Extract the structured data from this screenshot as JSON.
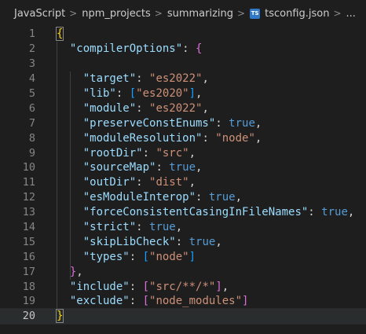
{
  "breadcrumb": {
    "items": [
      "JavaScript",
      "npm_projects",
      "summarizing"
    ],
    "file_icon": "TS",
    "file": "tsconfig.json",
    "tail": "..."
  },
  "editor": {
    "line_numbers": [
      "1",
      "2",
      "3",
      "4",
      "5",
      "6",
      "7",
      "8",
      "9",
      "10",
      "11",
      "12",
      "13",
      "14",
      "15",
      "16",
      "17",
      "18",
      "19",
      "20"
    ],
    "current_line": 20,
    "tokens": {
      "open_brace": "{",
      "close_brace": "}",
      "compilerOptions": "\"compilerOptions\"",
      "target": "\"target\"",
      "target_val": "\"es2022\"",
      "lib": "\"lib\"",
      "lib_val": "\"es2020\"",
      "module": "\"module\"",
      "module_val": "\"es2022\"",
      "preserveConstEnums": "\"preserveConstEnums\"",
      "moduleResolution": "\"moduleResolution\"",
      "moduleResolution_val": "\"node\"",
      "rootDir": "\"rootDir\"",
      "rootDir_val": "\"src\"",
      "sourceMap": "\"sourceMap\"",
      "outDir": "\"outDir\"",
      "outDir_val": "\"dist\"",
      "esModuleInterop": "\"esModuleInterop\"",
      "forceConsistentCasingInFileNames": "\"forceConsistentCasingInFileNames\"",
      "strict": "\"strict\"",
      "skipLibCheck": "\"skipLibCheck\"",
      "types": "\"types\"",
      "types_val": "\"node\"",
      "include": "\"include\"",
      "include_val": "\"src/**/*\"",
      "exclude": "\"exclude\"",
      "exclude_val": "\"node_modules\"",
      "true": "true"
    }
  },
  "colors": {
    "background": "#1e1e1e",
    "key": "#9cdcfe",
    "string": "#ce9178",
    "boolean": "#569cd6",
    "bracket_level1": "#ffd700",
    "bracket_level2": "#da70d6",
    "bracket_level3": "#179fff"
  }
}
